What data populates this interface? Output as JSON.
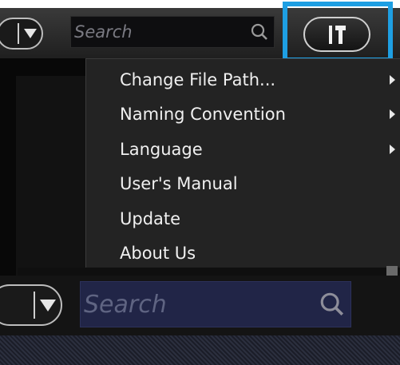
{
  "toolbar": {
    "search_placeholder": "Search",
    "dropdown_icon": "chevron-down-icon",
    "search_icon": "search-icon",
    "tools_icon": "tools-icon",
    "accent": "#1e9fe3"
  },
  "settings_menu": {
    "items": [
      {
        "label": "Change File Path...",
        "has_submenu": true
      },
      {
        "label": "Naming Convention",
        "has_submenu": true
      },
      {
        "label": "Language",
        "has_submenu": true
      },
      {
        "label": "User's Manual",
        "has_submenu": false
      },
      {
        "label": "Update",
        "has_submenu": false
      },
      {
        "label": "About Us",
        "has_submenu": false
      }
    ]
  },
  "lower_toolbar": {
    "search_placeholder": "Search"
  }
}
